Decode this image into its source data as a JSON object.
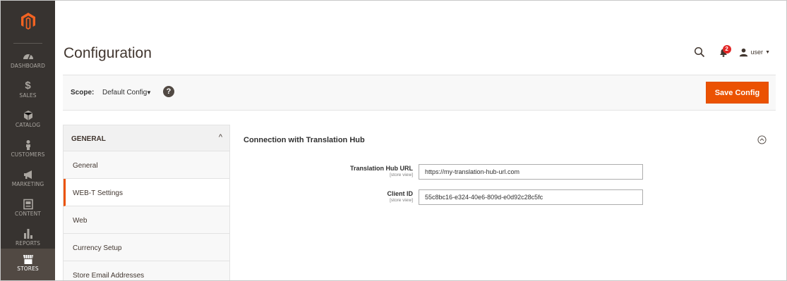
{
  "nav": {
    "items": [
      {
        "label": "DASHBOARD",
        "icon": "dashboard-icon"
      },
      {
        "label": "SALES",
        "icon": "dollar-icon"
      },
      {
        "label": "CATALOG",
        "icon": "cube-icon"
      },
      {
        "label": "CUSTOMERS",
        "icon": "person-icon"
      },
      {
        "label": "MARKETING",
        "icon": "megaphone-icon"
      },
      {
        "label": "CONTENT",
        "icon": "content-icon"
      },
      {
        "label": "REPORTS",
        "icon": "bar-chart-icon"
      },
      {
        "label": "STORES",
        "icon": "store-icon"
      }
    ],
    "active": "STORES"
  },
  "header": {
    "title": "Configuration",
    "notifications_count": "2",
    "user_name": "user"
  },
  "scope": {
    "label": "Scope:",
    "value": "Default Config",
    "help": "?",
    "save_label": "Save Config"
  },
  "tabs": {
    "section_label": "GENERAL",
    "items": [
      {
        "label": "General"
      },
      {
        "label": "WEB-T Settings"
      },
      {
        "label": "Web"
      },
      {
        "label": "Currency Setup"
      },
      {
        "label": "Store Email Addresses"
      }
    ],
    "active": "WEB-T Settings"
  },
  "main": {
    "section_title": "Connection with Translation Hub",
    "fields": [
      {
        "label": "Translation Hub URL",
        "scope": "[store view]",
        "value": "https://my-translation-hub-url.com"
      },
      {
        "label": "Client ID",
        "scope": "[store view]",
        "value": "55c8bc16-e324-40e6-809d-e0d92c28c5fc"
      }
    ]
  },
  "colors": {
    "nav_bg": "#373330",
    "nav_active": "#514943",
    "accent": "#eb5202"
  }
}
